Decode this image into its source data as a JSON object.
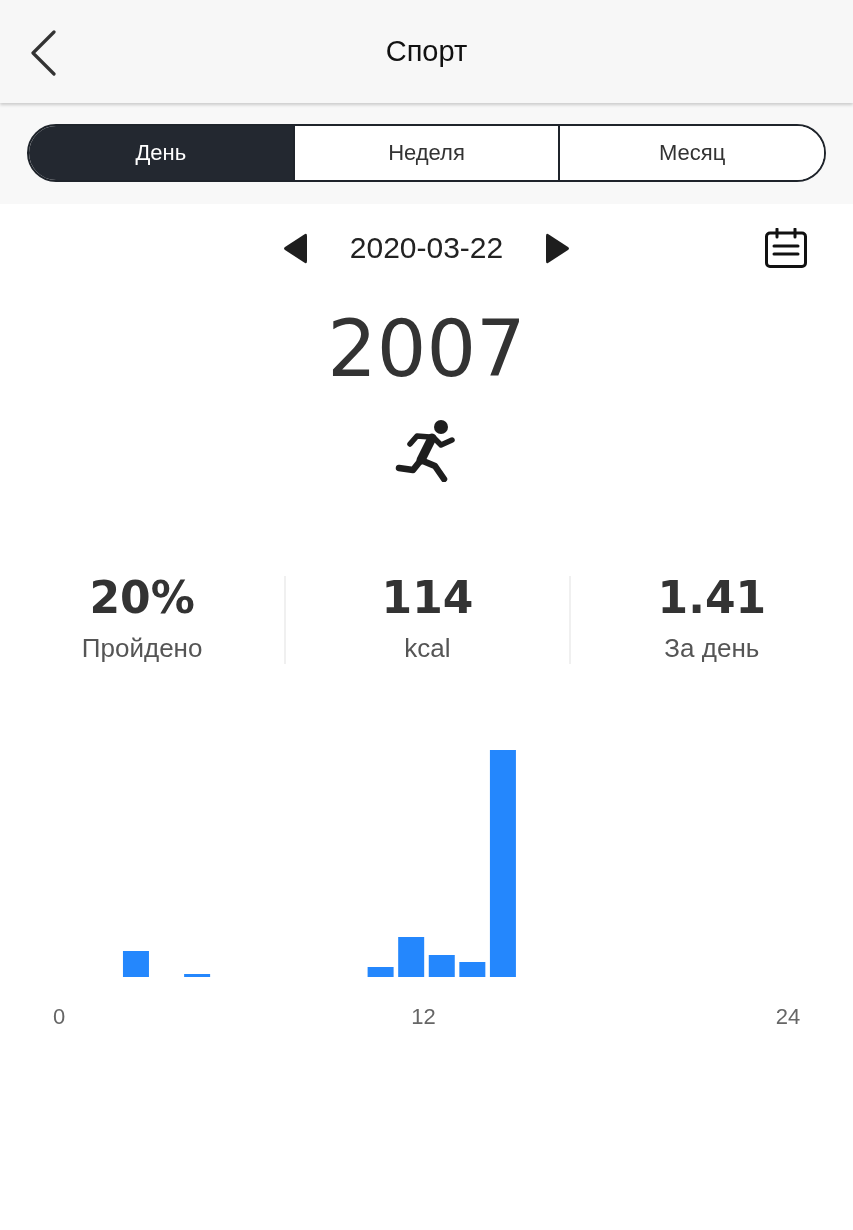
{
  "header": {
    "title": "Спорт"
  },
  "tabs": [
    {
      "label": "День",
      "selected": true
    },
    {
      "label": "Неделя",
      "selected": false
    },
    {
      "label": "Месяц",
      "selected": false
    }
  ],
  "date_nav": {
    "date": "2020-03-22"
  },
  "steps": {
    "value": "2007"
  },
  "stats": [
    {
      "value": "20%",
      "label": "Пройдено"
    },
    {
      "value": "114",
      "label": "kcal"
    },
    {
      "value": "1.41",
      "label": "За день"
    }
  ],
  "chart": {
    "axis_labels": [
      "0",
      "12",
      "24"
    ]
  }
}
